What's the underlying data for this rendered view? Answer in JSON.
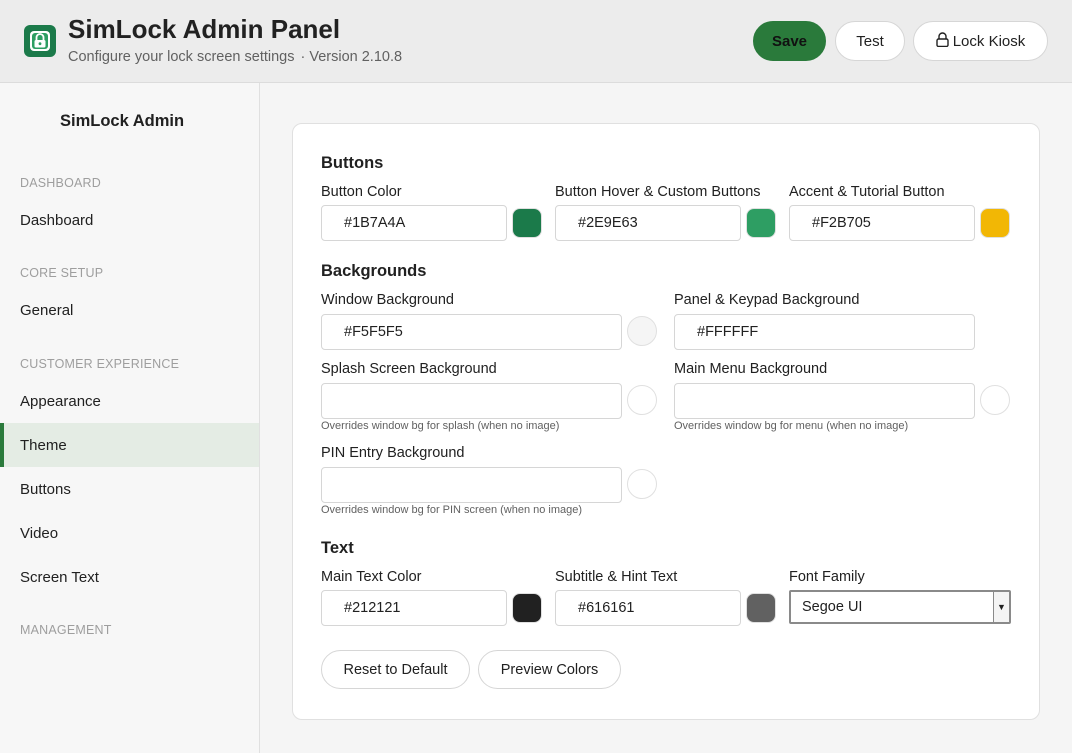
{
  "header": {
    "title": "SimLock Admin Panel",
    "subtitle": "Configure your lock screen settings",
    "version": "· Version 2.10.8",
    "save_label": "Save",
    "test_label": "Test",
    "lock_label": "Lock Kiosk",
    "accent_color": "#1B7A4A"
  },
  "sidebar": {
    "title": "SimLock Admin",
    "sections": {
      "dashboard": "DASHBOARD",
      "core_setup": "CORE SETUP",
      "customer_experience": "CUSTOMER EXPERIENCE",
      "management": "MANAGEMENT"
    },
    "items": {
      "dashboard": "Dashboard",
      "general": "General",
      "appearance": "Appearance",
      "theme": "Theme",
      "buttons": "Buttons",
      "video": "Video",
      "screen_text": "Screen Text"
    },
    "active_item": "Theme"
  },
  "buttons_section": {
    "heading": "Buttons",
    "button_color": {
      "label": "Button Color",
      "value": "#1B7A4A"
    },
    "button_hover": {
      "label": "Button Hover & Custom Buttons",
      "value": "#2E9E63"
    },
    "accent": {
      "label": "Accent & Tutorial Button",
      "value": "#F2B705"
    }
  },
  "backgrounds_section": {
    "heading": "Backgrounds",
    "window_bg": {
      "label": "Window Background",
      "value": "#F5F5F5"
    },
    "panel_bg": {
      "label": "Panel & Keypad Background",
      "value": "#FFFFFF"
    },
    "splash_bg": {
      "label": "Splash Screen Background",
      "value": "",
      "hint": "Overrides window bg for splash (when no image)"
    },
    "menu_bg": {
      "label": "Main Menu Background",
      "value": "",
      "hint": "Overrides window bg for menu (when no image)"
    },
    "pin_bg": {
      "label": "PIN Entry Background",
      "value": "",
      "hint": "Overrides window bg for PIN screen (when no image)"
    }
  },
  "text_section": {
    "heading": "Text",
    "main_text": {
      "label": "Main Text Color",
      "value": "#212121"
    },
    "subtitle_text": {
      "label": "Subtitle & Hint Text",
      "value": "#616161"
    },
    "font_family": {
      "label": "Font Family",
      "value": "Segoe UI"
    }
  },
  "footer": {
    "reset_label": "Reset to Default",
    "preview_label": "Preview Colors"
  }
}
